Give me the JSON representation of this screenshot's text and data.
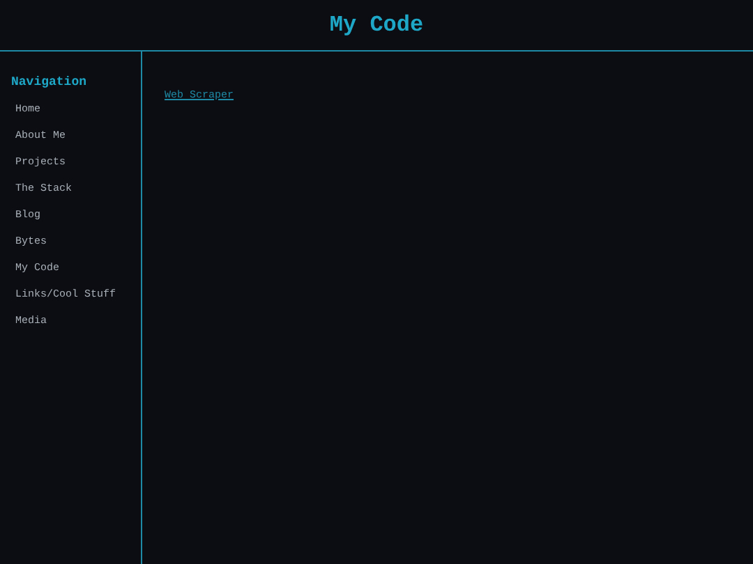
{
  "header": {
    "title": "My Code"
  },
  "sidebar": {
    "heading": "Navigation",
    "items": [
      {
        "label": "Home"
      },
      {
        "label": "About Me"
      },
      {
        "label": "Projects"
      },
      {
        "label": "The Stack"
      },
      {
        "label": "Blog"
      },
      {
        "label": "Bytes"
      },
      {
        "label": "My Code"
      },
      {
        "label": "Links/Cool Stuff"
      },
      {
        "label": "Media"
      }
    ]
  },
  "content": {
    "links": [
      {
        "label": "Web Scraper"
      }
    ]
  }
}
